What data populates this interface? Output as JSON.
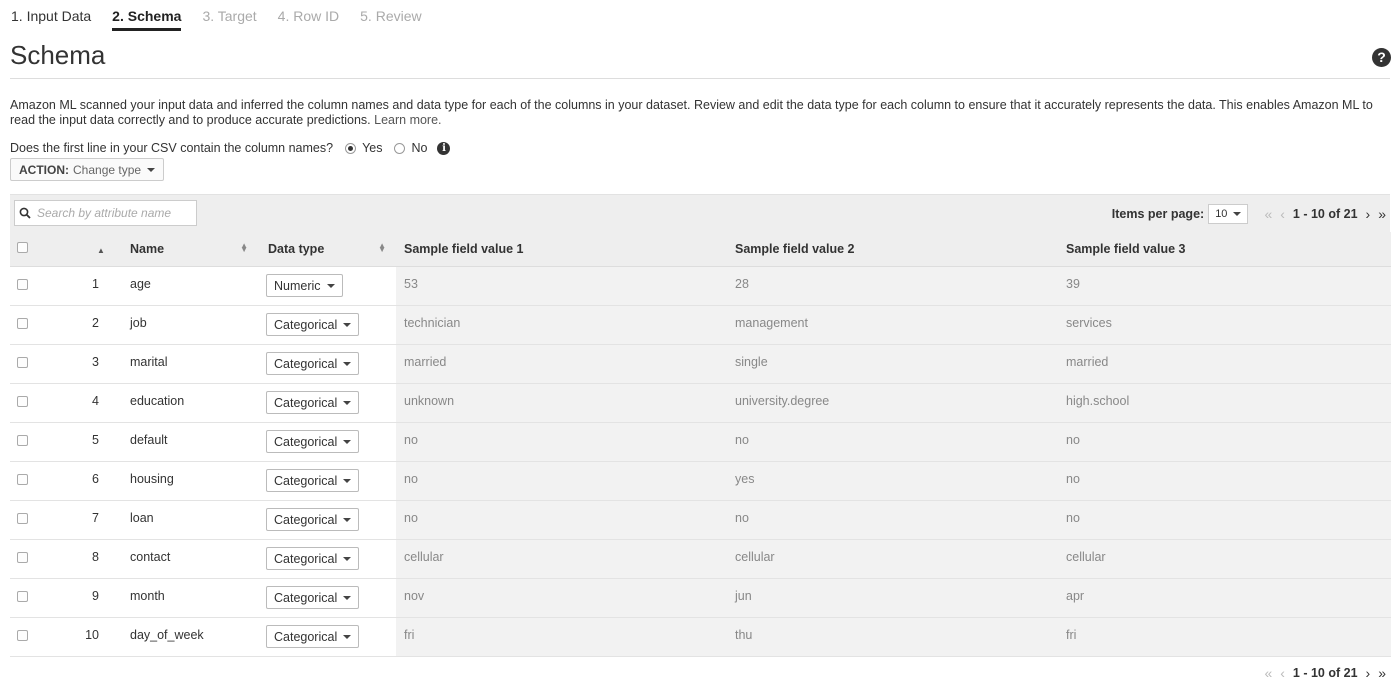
{
  "steps": [
    "1. Input Data",
    "2. Schema",
    "3. Target",
    "4. Row ID",
    "5. Review"
  ],
  "title": "Schema",
  "help_icon": "?",
  "description": "Amazon ML scanned your input data and inferred the column names and data type for each of the columns in your dataset. Review and edit the data type for each column to ensure that it accurately represents the data. This enables Amazon ML to read the input data correctly and to produce accurate predictions.",
  "learn_more": "Learn more.",
  "csv_question": "Does the first line in your CSV contain the column names?",
  "csv_yes": "Yes",
  "csv_no": "No",
  "info_icon": "i",
  "action": {
    "label": "ACTION:",
    "value": "Change type"
  },
  "search": {
    "placeholder": "Search by attribute name"
  },
  "pager": {
    "items_per_page_label": "Items per page:",
    "items_per_page": "10",
    "first": "«",
    "prev": "‹",
    "range": "1 - 10 of 21",
    "next": "›",
    "last": "»"
  },
  "table": {
    "headers": {
      "name": "Name",
      "data_type": "Data type",
      "s1": "Sample field value 1",
      "s2": "Sample field value 2",
      "s3": "Sample field value 3"
    },
    "rows": [
      {
        "idx": "1",
        "name": "age",
        "type": "Numeric",
        "s1": "53",
        "s2": "28",
        "s3": "39"
      },
      {
        "idx": "2",
        "name": "job",
        "type": "Categorical",
        "s1": "technician",
        "s2": "management",
        "s3": "services"
      },
      {
        "idx": "3",
        "name": "marital",
        "type": "Categorical",
        "s1": "married",
        "s2": "single",
        "s3": "married"
      },
      {
        "idx": "4",
        "name": "education",
        "type": "Categorical",
        "s1": "unknown",
        "s2": "university.degree",
        "s3": "high.school"
      },
      {
        "idx": "5",
        "name": "default",
        "type": "Categorical",
        "s1": "no",
        "s2": "no",
        "s3": "no"
      },
      {
        "idx": "6",
        "name": "housing",
        "type": "Categorical",
        "s1": "no",
        "s2": "yes",
        "s3": "no"
      },
      {
        "idx": "7",
        "name": "loan",
        "type": "Categorical",
        "s1": "no",
        "s2": "no",
        "s3": "no"
      },
      {
        "idx": "8",
        "name": "contact",
        "type": "Categorical",
        "s1": "cellular",
        "s2": "cellular",
        "s3": "cellular"
      },
      {
        "idx": "9",
        "name": "month",
        "type": "Categorical",
        "s1": "nov",
        "s2": "jun",
        "s3": "apr"
      },
      {
        "idx": "10",
        "name": "day_of_week",
        "type": "Categorical",
        "s1": "fri",
        "s2": "thu",
        "s3": "fri"
      }
    ]
  }
}
